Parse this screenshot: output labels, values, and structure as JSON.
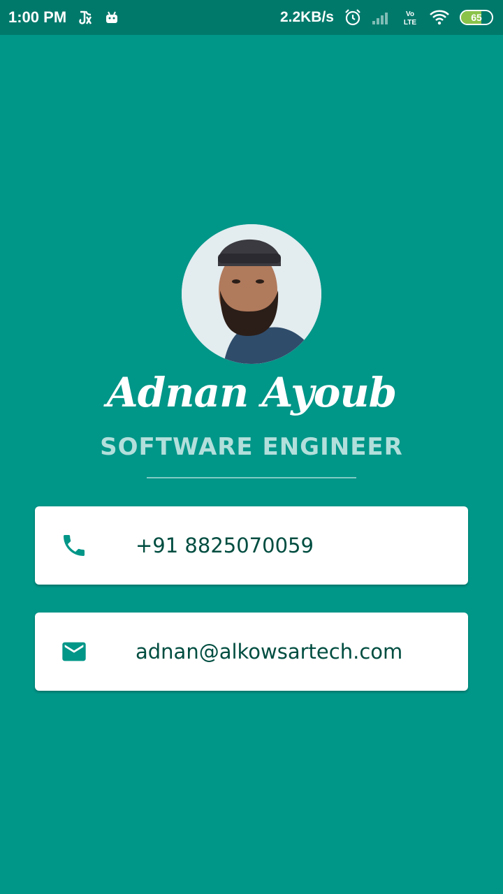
{
  "status_bar": {
    "time": "1:00 PM",
    "net_speed": "2.2KB/s",
    "battery_level": "65",
    "battery_fraction": 0.65,
    "icons": [
      "tiktok-notification-icon",
      "android-icon",
      "alarm-icon",
      "signal-icon",
      "volte-icon",
      "wifi-icon",
      "battery-icon"
    ]
  },
  "profile": {
    "name": "Adnan Ayoub",
    "title": "SOFTWARE ENGINEER",
    "avatar": "avatar-photo"
  },
  "contacts": [
    {
      "icon": "phone-icon",
      "value": "+91 8825070059"
    },
    {
      "icon": "email-icon",
      "value": "adnan@alkowsartech.com"
    }
  ],
  "colors": {
    "background": "#009688",
    "status_bar": "#00796B",
    "card_text": "#004D40",
    "icon": "#009688",
    "subtitle": "#B2DFDB"
  }
}
